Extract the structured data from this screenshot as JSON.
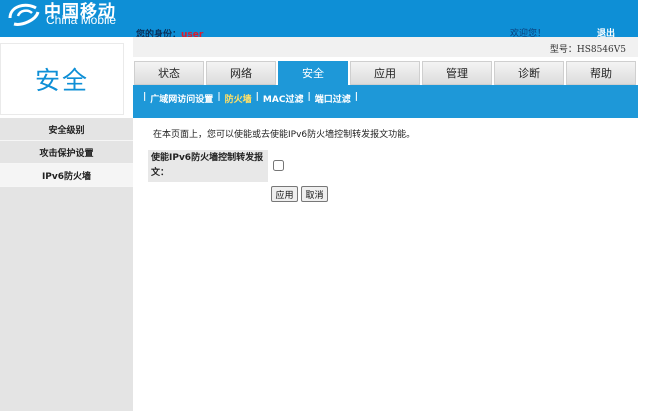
{
  "header": {
    "logo_cn": "中国移动",
    "logo_en": "China Mobile",
    "identity_label": "您的身份：",
    "identity_user": "user",
    "welcome": "欢迎您！",
    "logout": "退出",
    "model": "型号：HS8546V5"
  },
  "section_title": "安全",
  "tabs": [
    {
      "label": "状态"
    },
    {
      "label": "网络"
    },
    {
      "label": "安全",
      "active": true
    },
    {
      "label": "应用"
    },
    {
      "label": "管理"
    },
    {
      "label": "诊断"
    },
    {
      "label": "帮助"
    }
  ],
  "subnav": {
    "separator": "|",
    "items": [
      {
        "label": "广域网访问设置"
      },
      {
        "label": "防火墙",
        "active": true
      },
      {
        "label": "MAC过滤"
      },
      {
        "label": "端口过滤"
      }
    ]
  },
  "sidebar": {
    "items": [
      {
        "label": "安全级别"
      },
      {
        "label": "攻击保护设置"
      },
      {
        "label": "IPv6防火墙",
        "active": true
      }
    ]
  },
  "main": {
    "description": "在本页面上，您可以使能或去使能IPv6防火墙控制转发报文功能。",
    "form_label": "使能IPv6防火墙控制转发报文：",
    "checked": false,
    "apply_label": "应用",
    "cancel_label": "取消"
  },
  "colors": {
    "brand_blue": "#0e8fd6",
    "active_tab": "#1e98d8",
    "identity_user": "#e0192b"
  }
}
